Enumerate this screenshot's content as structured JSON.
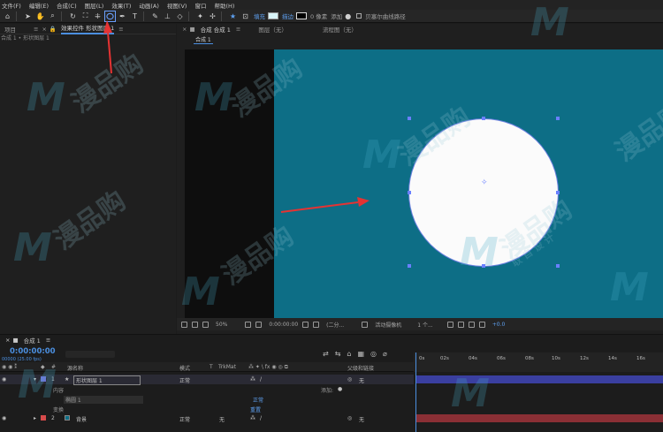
{
  "menu": [
    "文件(F)",
    "编辑(E)",
    "合成(C)",
    "图层(L)",
    "效果(T)",
    "动画(A)",
    "视图(V)",
    "窗口",
    "帮助(H)"
  ],
  "toolbar": {
    "fill_label": "填充",
    "stroke_label": "描边",
    "stroke_px": "0 像素",
    "add_label": "添加",
    "bezier_label": "贝塞尔曲线路径",
    "fill_color": "#d8f4f8",
    "stroke_color": "#000000"
  },
  "left_panel": {
    "tab_project": "项目",
    "tab_effects": "效果控件 形状图层 1",
    "breadcrumb": "合成 1 • 形状图层 1"
  },
  "comp_panel": {
    "tab_comp": "合成 合成 1",
    "tab_layer": "图层（无）",
    "tab_flowchart": "流程图（无）",
    "subtab": "合成 1",
    "canvas_color": "#0d6e86",
    "viewer_bar": {
      "zoom": "50%",
      "time": "0:00:00:00",
      "resolution": "(二分...",
      "camera": "活动摄像机",
      "views": "1 个...",
      "exposure": "+0.0"
    }
  },
  "timeline": {
    "tab": "合成 1",
    "timecode": "0:00:00:00",
    "frames": "00000 (25.00 fps)",
    "columns": {
      "source": "源名称",
      "mode": "模式",
      "t": "T",
      "trkmat": "TrkMat",
      "parent": "父级和链接"
    },
    "layers": [
      {
        "num": "1",
        "name": "形状图层 1",
        "mode": "正常",
        "parent": "无",
        "color": "#6f6fd6"
      },
      {
        "num": "2",
        "name": "背景",
        "mode": "正常",
        "trkmat": "无",
        "parent": "无",
        "color": "#d64b4b"
      }
    ],
    "sub_rows": {
      "contents": "内容",
      "add": "添加:",
      "ellipse": "椭圆 1",
      "ellipse_mode": "正常",
      "transform": "变换",
      "reset": "重置"
    },
    "ruler": [
      "0s",
      "02s",
      "04s",
      "06s",
      "08s",
      "10s",
      "12s",
      "14s",
      "16s"
    ]
  },
  "watermark": {
    "brand": "漫品购",
    "sub": "取 自 设 计"
  }
}
